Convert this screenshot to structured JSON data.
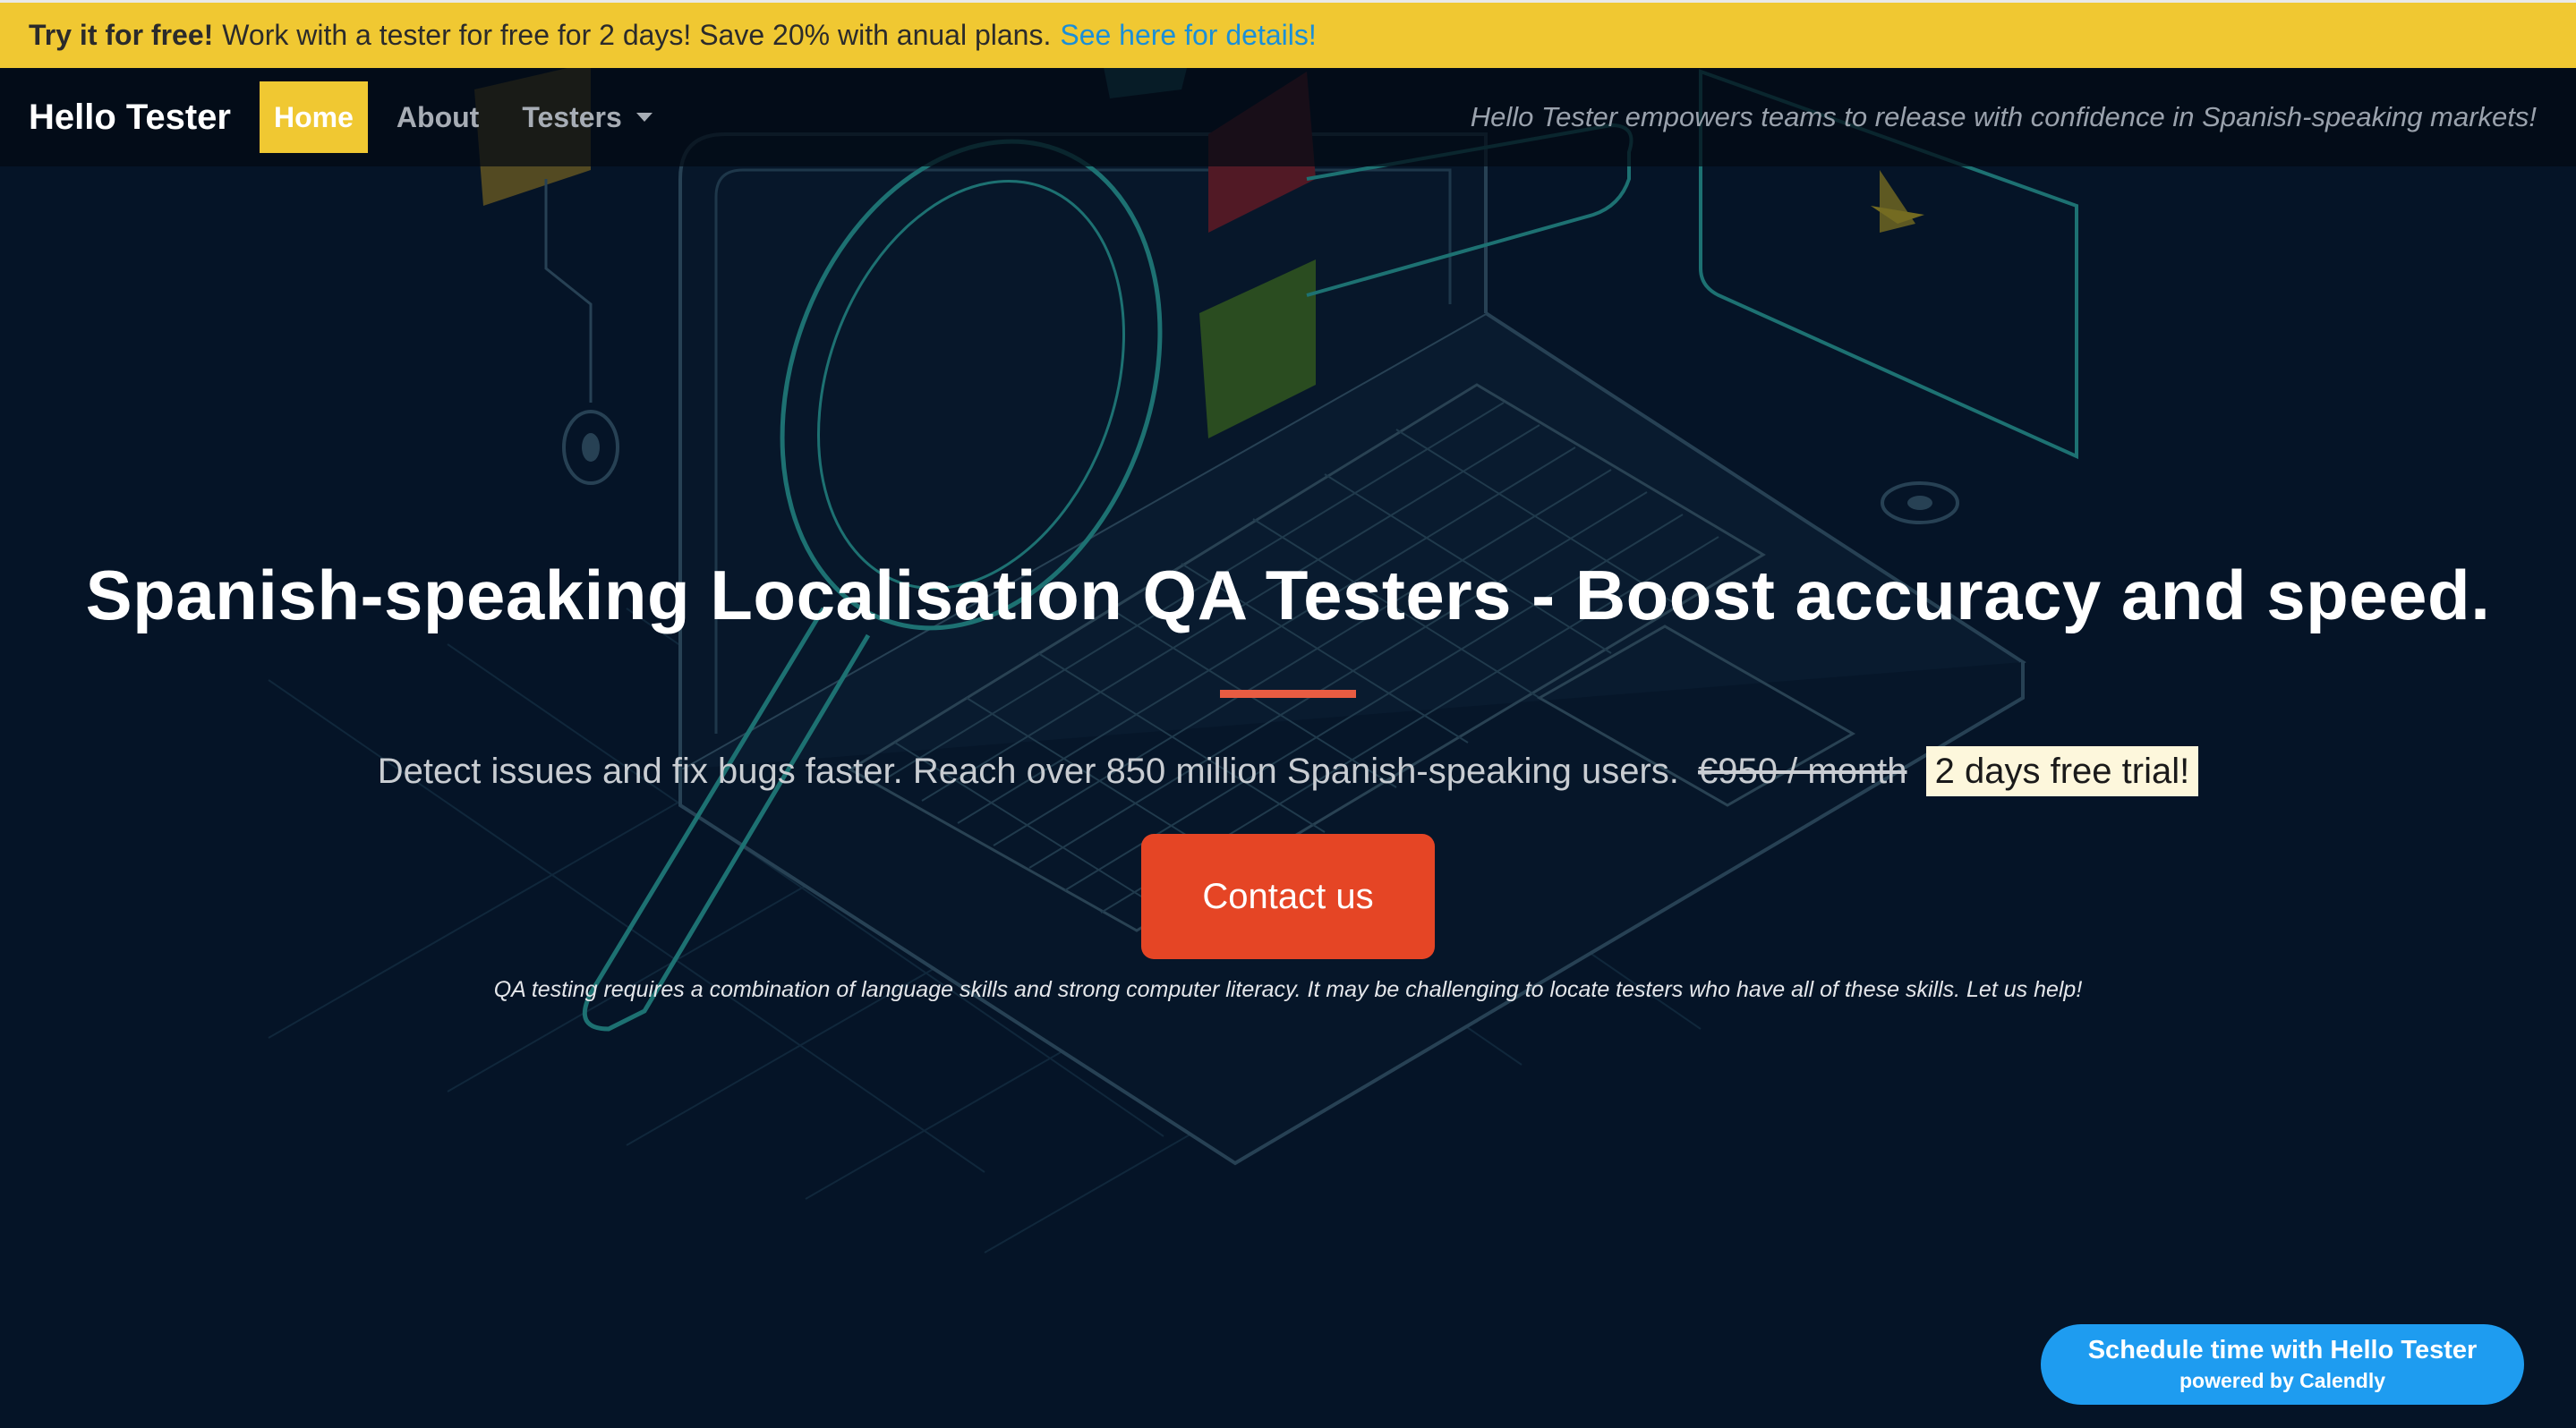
{
  "promo": {
    "bold": "Try it for free!",
    "text": "Work with a tester for free for 2 days! Save 20% with anual plans.",
    "link": "See here for details!"
  },
  "nav": {
    "brand": "Hello Tester",
    "items": [
      {
        "label": "Home",
        "active": true
      },
      {
        "label": "About"
      },
      {
        "label": "Testers",
        "dropdown": true
      }
    ],
    "tagline": "Hello Tester empowers teams to release with confidence in Spanish-speaking markets!"
  },
  "hero": {
    "title": "Spanish-speaking Localisation QA Testers - Boost accuracy and speed.",
    "subtitle": "Detect issues and fix bugs faster. Reach over 850 million Spanish-speaking users.",
    "old_price": "€950 / month",
    "trial": "2 days free trial!",
    "cta": "Contact us",
    "note": "QA testing requires a combination of language skills and strong computer literacy. It may be challenging to locate testers who have all of these skills. Let us help!"
  },
  "calendly": {
    "main": "Schedule time with Hello Tester",
    "sub": "powered by Calendly"
  },
  "colors": {
    "background": "#051427",
    "banner": "#f0c832",
    "accent_red": "#e54525",
    "link_blue": "#1a8fd8",
    "calendly_blue": "#1e9cf0",
    "illustration_teal": "#2aa39a"
  }
}
